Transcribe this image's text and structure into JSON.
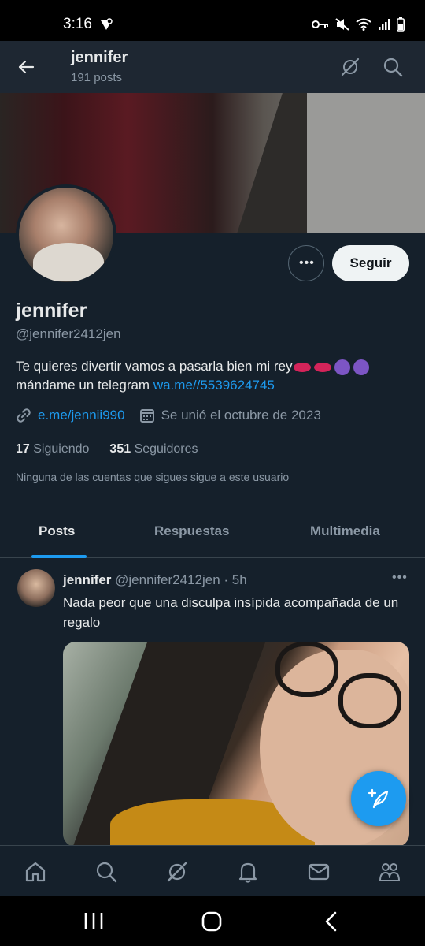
{
  "status_bar": {
    "time": "3:16"
  },
  "header": {
    "name": "jennifer",
    "post_count": "191 posts"
  },
  "profile": {
    "display_name": "jennifer",
    "handle": "@jennifer2412jen",
    "bio_line1": "Te quieres divertir vamos a pasarla bien mi rey",
    "bio_line2": "mándame un telegram ",
    "bio_link": "wa.me//5539624745",
    "website": "e.me/jennii990",
    "joined": "Se unió el octubre de 2023",
    "following_count": "17",
    "following_label": "Siguiendo",
    "followers_count": "351",
    "followers_label": "Seguidores",
    "mutuals_note": "Ninguna de las cuentas que sigues sigue a este usuario",
    "follow_button": "Seguir",
    "more_button": "•••"
  },
  "tabs": [
    {
      "label": "Posts",
      "active": true
    },
    {
      "label": "Respuestas",
      "active": false
    },
    {
      "label": "Multimedia",
      "active": false
    }
  ],
  "tweet": {
    "name": "jennifer",
    "handle_time": "@jennifer2412jen · 5h",
    "text": "Nada peor que una disculpa insípida acompañada de un regalo",
    "more": "•••"
  },
  "colors": {
    "background": "#15202b",
    "accent": "#1d9bf0",
    "secondary_text": "#8b98a5"
  },
  "icons": [
    "back-arrow-icon",
    "grok-icon",
    "search-icon",
    "link-icon",
    "calendar-icon",
    "compose-icon",
    "home-icon",
    "bell-icon",
    "mail-icon",
    "communities-icon"
  ]
}
